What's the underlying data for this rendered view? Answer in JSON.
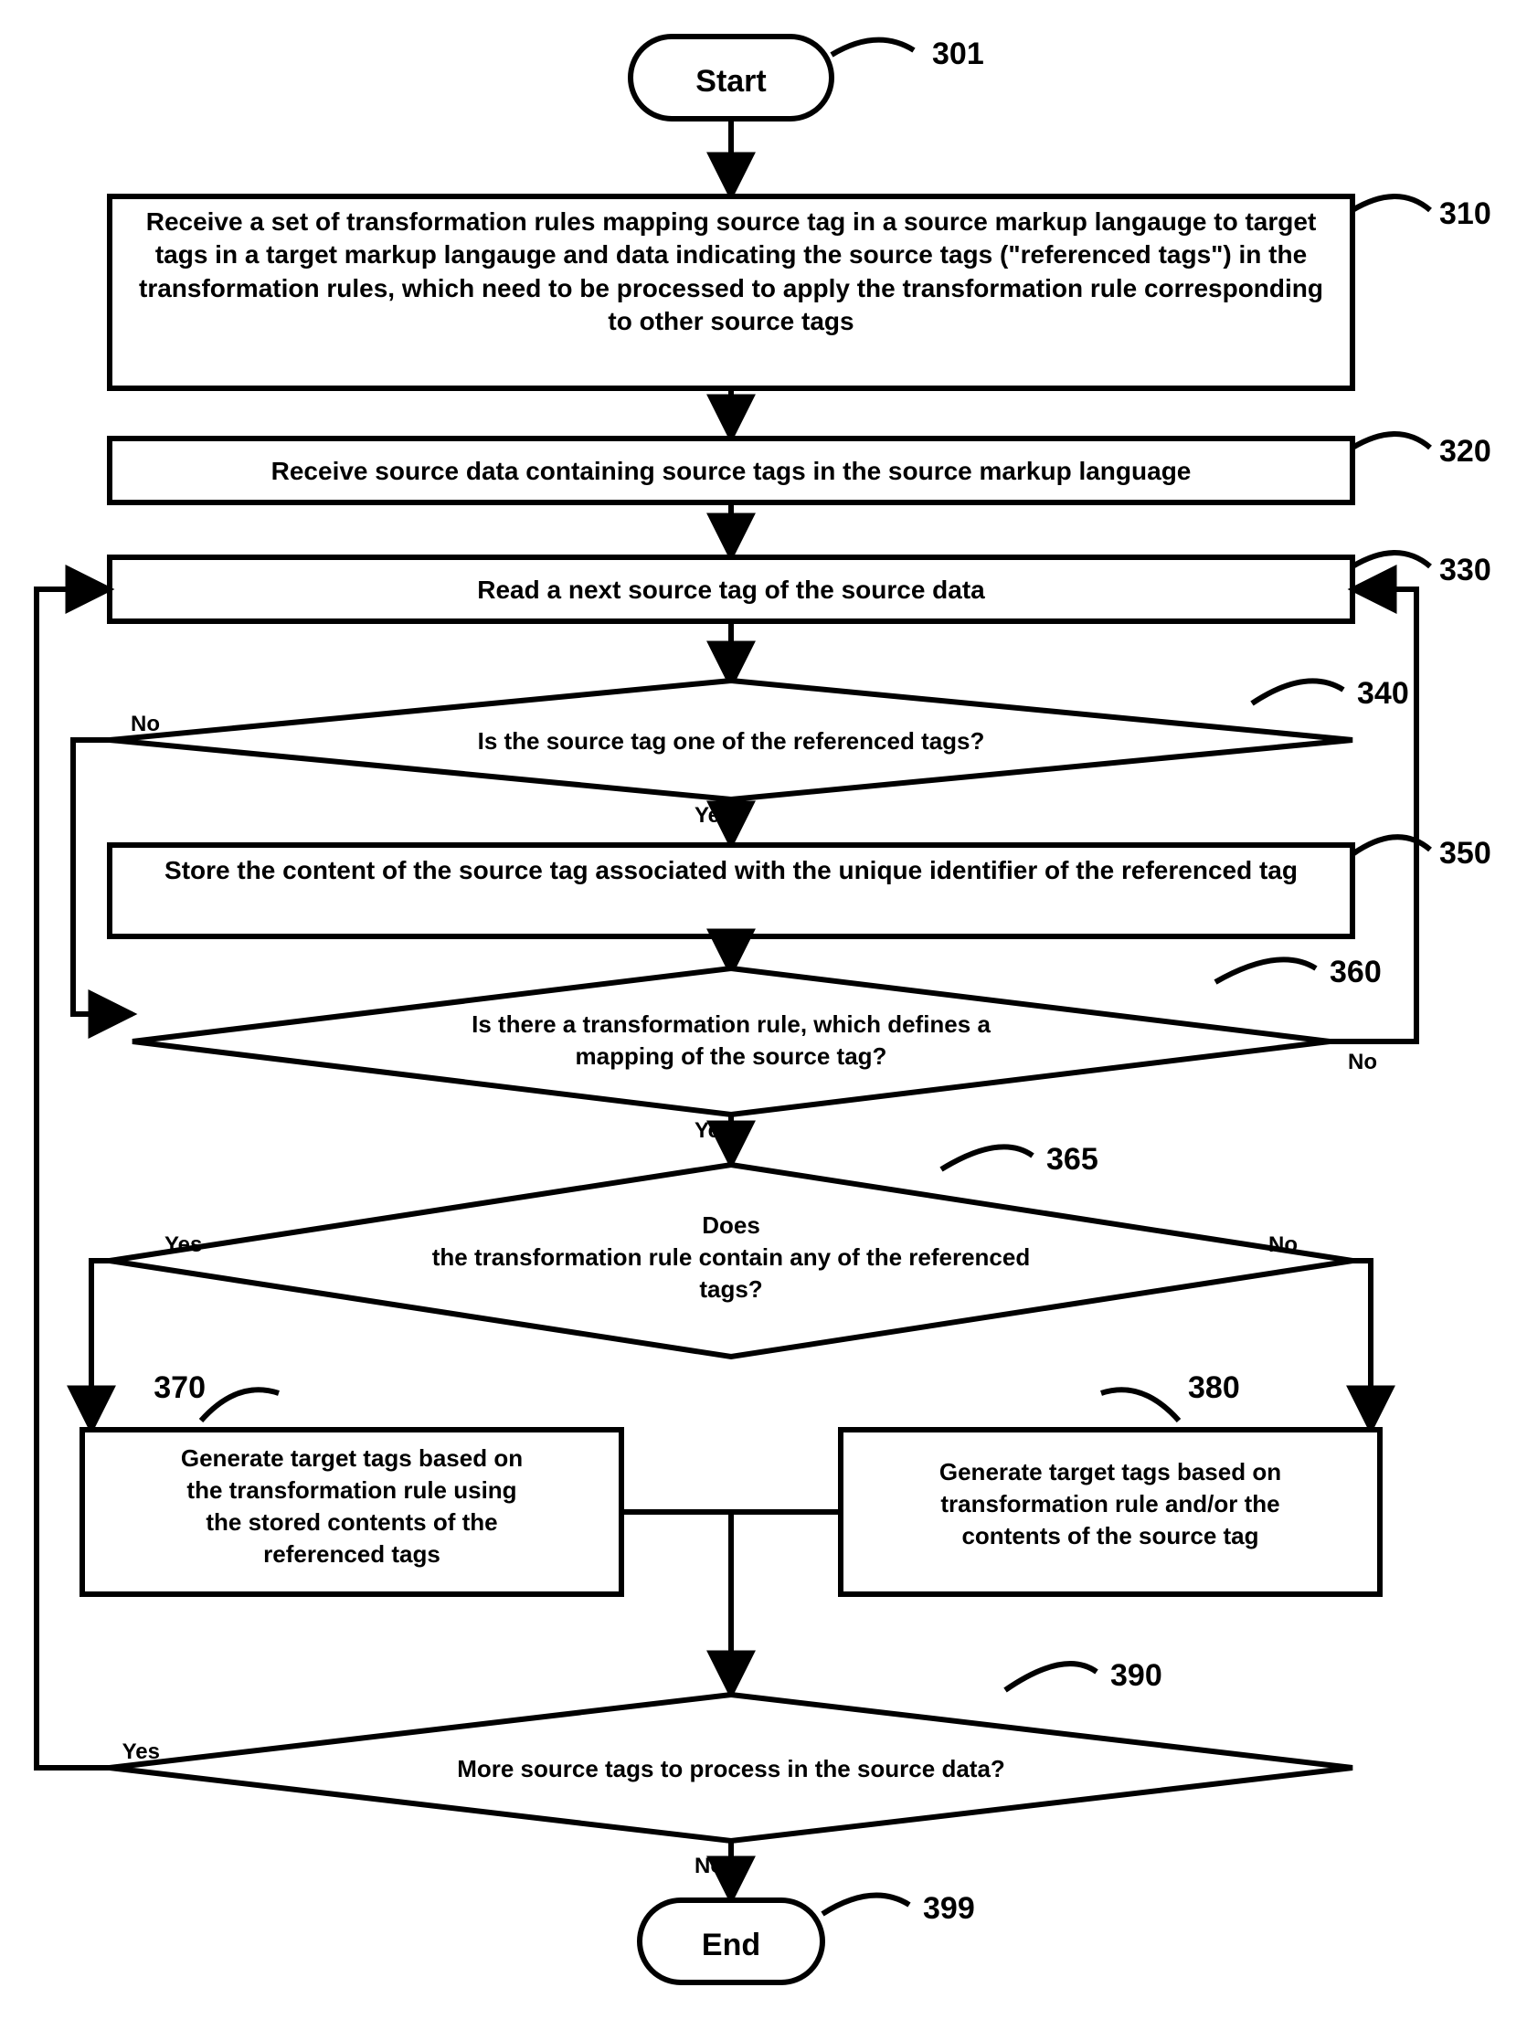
{
  "chart_data": {
    "type": "flowchart",
    "nodes": [
      {
        "id": "301",
        "kind": "terminator",
        "text": "Start"
      },
      {
        "id": "310",
        "kind": "process",
        "text": "Receive a set of transformation rules mapping source tag in a source markup langauge  to target tags in a target markup langauge and data indicating the source tags (\"referenced tags\") in the transformation rules, which need to be processed to apply the transformation rule corresponding to other source tags"
      },
      {
        "id": "320",
        "kind": "process",
        "text": "Receive source data containing source tags in the source markup language"
      },
      {
        "id": "330",
        "kind": "process",
        "text": "Read a next source tag of the source data"
      },
      {
        "id": "340",
        "kind": "decision",
        "text": "Is the source tag one of the referenced tags?"
      },
      {
        "id": "350",
        "kind": "process",
        "text": "Store the content of the source tag associated with the unique identifier of the referenced tag"
      },
      {
        "id": "360",
        "kind": "decision",
        "text": "Is there a transformation rule, which defines a mapping of the source tag?"
      },
      {
        "id": "365",
        "kind": "decision",
        "text": "Does the transformation rule contain any of the referenced tags?"
      },
      {
        "id": "370",
        "kind": "process",
        "text": "Generate target tags based on the transformation rule using the stored contents of the referenced tags"
      },
      {
        "id": "380",
        "kind": "process",
        "text": "Generate target tags based on transformation rule and/or the contents of the source tag"
      },
      {
        "id": "390",
        "kind": "decision",
        "text": "More source tags to process in the source data?"
      },
      {
        "id": "399",
        "kind": "terminator",
        "text": "End"
      }
    ],
    "edges": [
      {
        "from": "301",
        "to": "310"
      },
      {
        "from": "310",
        "to": "320"
      },
      {
        "from": "320",
        "to": "330"
      },
      {
        "from": "330",
        "to": "340"
      },
      {
        "from": "340",
        "to": "350",
        "label": "Yes"
      },
      {
        "from": "340",
        "to": "360",
        "label": "No"
      },
      {
        "from": "350",
        "to": "360"
      },
      {
        "from": "360",
        "to": "365",
        "label": "Yes"
      },
      {
        "from": "360",
        "to": "330",
        "label": "No"
      },
      {
        "from": "365",
        "to": "370",
        "label": "Yes"
      },
      {
        "from": "365",
        "to": "380",
        "label": "No"
      },
      {
        "from": "370",
        "to": "390"
      },
      {
        "from": "380",
        "to": "390"
      },
      {
        "from": "390",
        "to": "330",
        "label": "Yes"
      },
      {
        "from": "390",
        "to": "399",
        "label": "No"
      }
    ]
  },
  "labels": {
    "start": "Start",
    "end": "End",
    "n310": "Receive a set of transformation rules mapping source tag in a source markup langauge  to target tags in a target markup langauge and data indicating the source tags (\"referenced tags\") in the transformation rules, which need to be processed to apply the transformation rule corresponding to other source tags",
    "n320": "Receive source data containing source tags in the source markup language",
    "n330": "Read a next source tag of the source data",
    "n340": "Is the source tag one of the referenced tags?",
    "n350": "Store the content of the source tag associated with the unique identifier of the referenced tag",
    "n360_l1": "Is there a transformation rule, which defines a",
    "n360_l2": "mapping of the source tag?",
    "n365_l1": "Does",
    "n365_l2": "the transformation rule contain any of the referenced",
    "n365_l3": "tags?",
    "n370_l1": "Generate target tags based on",
    "n370_l2": "the transformation rule using",
    "n370_l3": "the stored contents of the",
    "n370_l4": "referenced tags",
    "n380_l1": "Generate target tags based on",
    "n380_l2": "transformation rule and/or the",
    "n380_l3": "contents of the source tag",
    "n390": "More source tags to process in the source data?",
    "yes": "Yes",
    "no": "No",
    "ref301": "301",
    "ref310": "310",
    "ref320": "320",
    "ref330": "330",
    "ref340": "340",
    "ref350": "350",
    "ref360": "360",
    "ref365": "365",
    "ref370": "370",
    "ref380": "380",
    "ref390": "390",
    "ref399": "399"
  }
}
